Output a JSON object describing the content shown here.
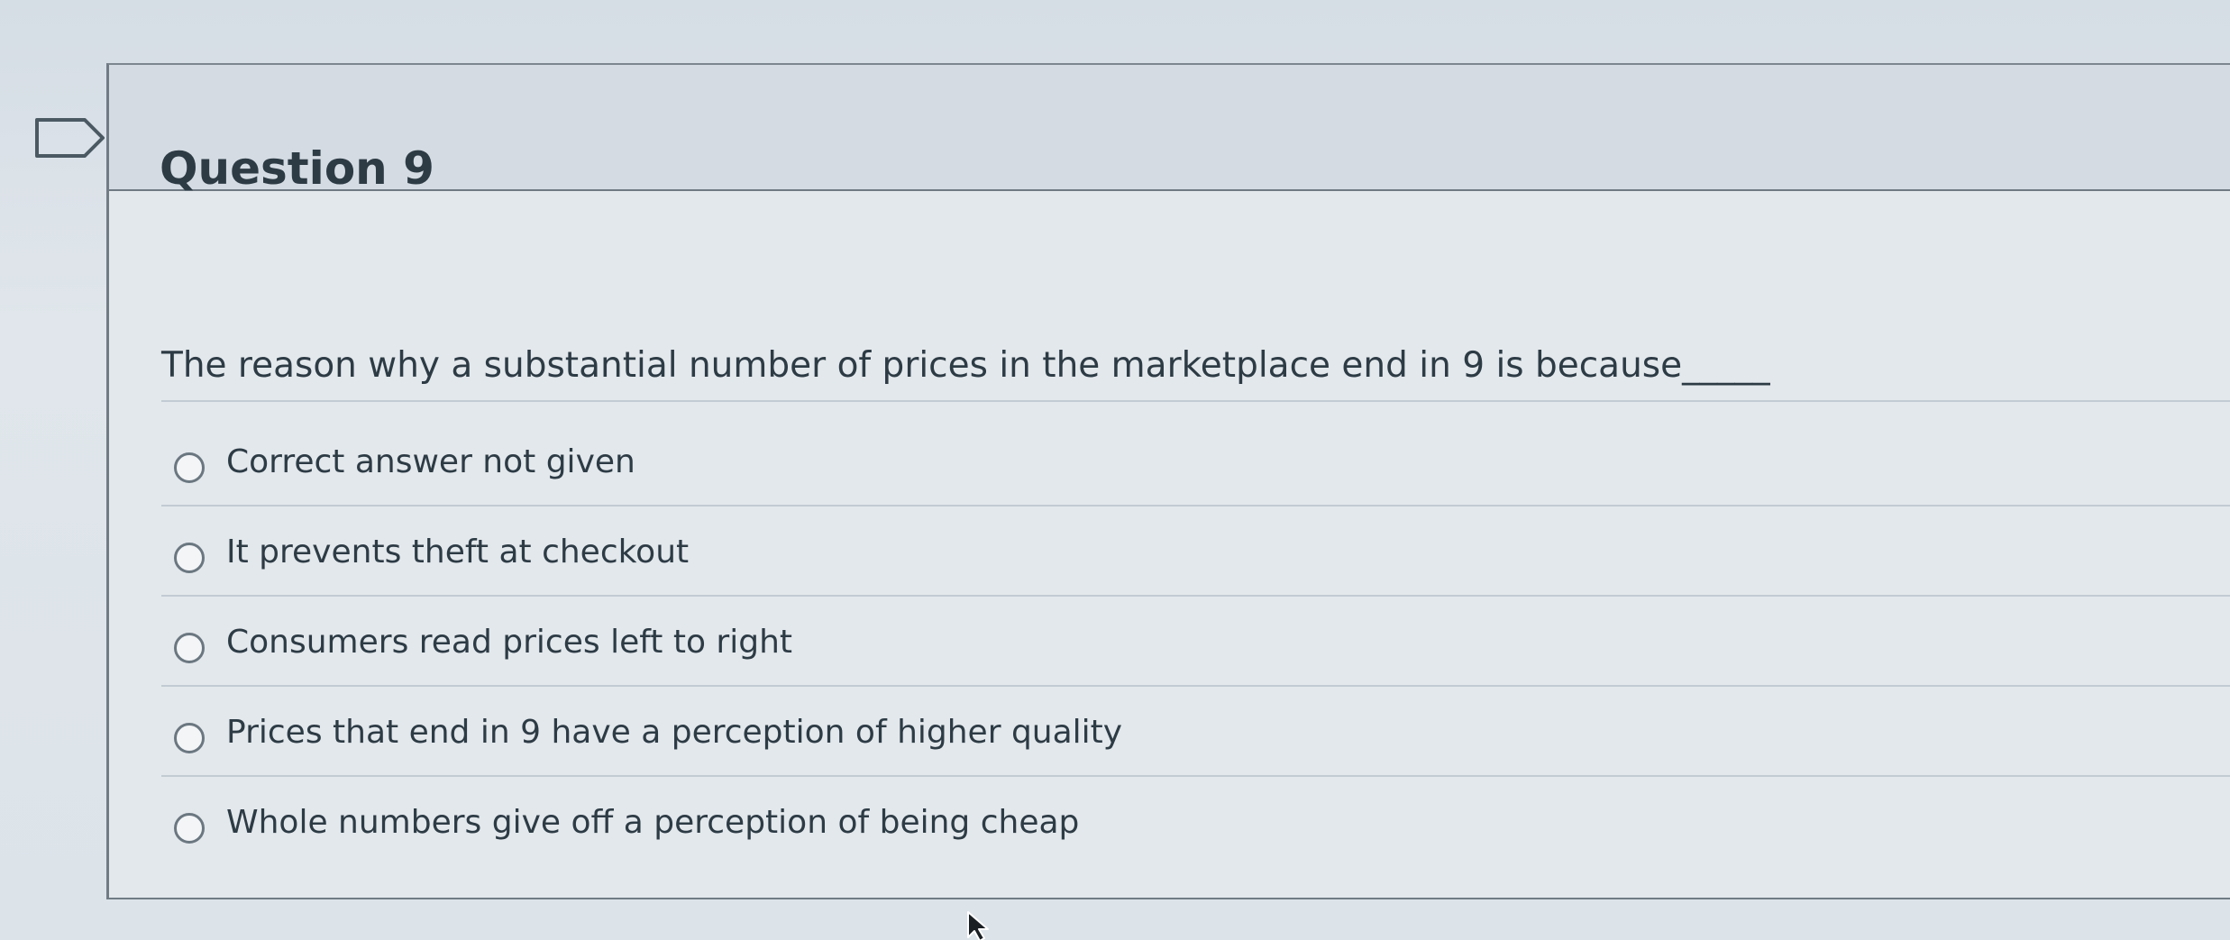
{
  "question": {
    "title": "Question 9",
    "prompt": "The reason why a substantial number of prices in the marketplace end in 9 is because_____",
    "answers": [
      {
        "label": "Correct answer not given",
        "selected": false
      },
      {
        "label": "It prevents theft at checkout",
        "selected": false
      },
      {
        "label": "Consumers read prices left to right",
        "selected": false
      },
      {
        "label": "Prices that end in 9 have a perception of higher quality",
        "selected": false
      },
      {
        "label": "Whole numbers give off a perception of being cheap",
        "selected": false
      }
    ]
  },
  "icons": {
    "flag": "flag-question-icon",
    "cursor": "mouse-pointer-icon"
  },
  "colors": {
    "text": "#2d3b45",
    "header_background": "#d4dbe2",
    "body_background": "#e3e8ec",
    "divider": "#c2cbd3"
  }
}
